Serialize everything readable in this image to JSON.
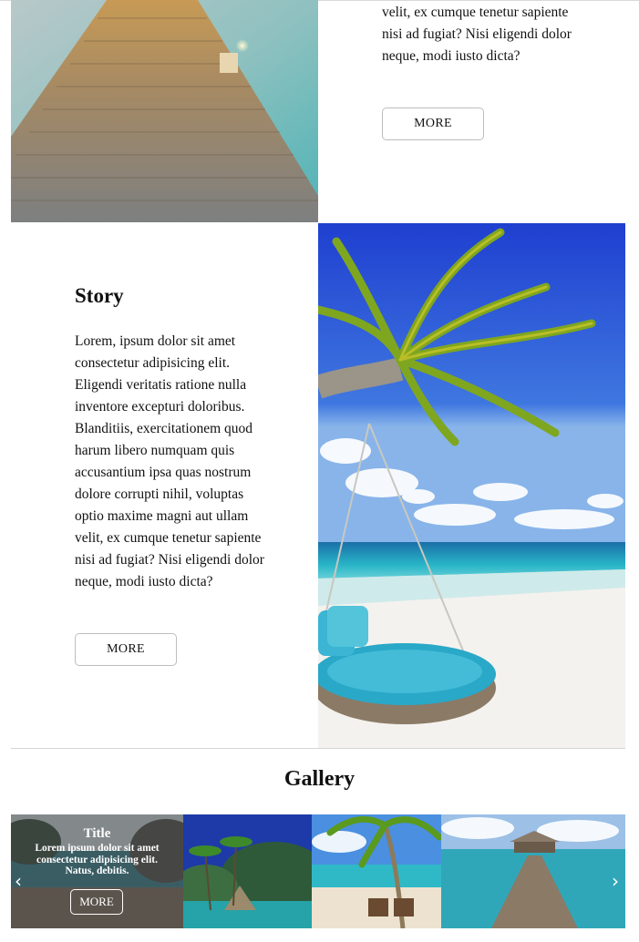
{
  "row1": {
    "text": "velit, ex cumque tenetur sapiente nisi ad fugiat? Nisi eligendi dolor neque, modi iusto dicta?",
    "more_label": "MORE",
    "image_icon": "pier-sunset-photo"
  },
  "story": {
    "title": "Story",
    "text": "Lorem, ipsum dolor sit amet consectetur adipisicing elit. Eligendi veritatis ratione nulla inventore excepturi doloribus. Blanditiis, exercitationem quod harum libero numquam quis accusantium ipsa quas nostrum dolore corrupti nihil, voluptas optio maxime magni aut ullam velit, ex cumque tenetur sapiente nisi ad fugiat? Nisi eligendi dolor neque, modi iusto dicta?",
    "more_label": "MORE",
    "image_icon": "palm-hammock-beach-photo"
  },
  "gallery": {
    "title": "Gallery",
    "overlay": {
      "title": "Title",
      "text": "Lorem ipsum dolor sit amet consectetur adipisicing elit. Natus, debitis.",
      "more_label": "MORE"
    },
    "prev_icon": "chevron-left-icon",
    "next_icon": "chevron-right-icon",
    "prev_glyph": "‹",
    "next_glyph": "›"
  }
}
